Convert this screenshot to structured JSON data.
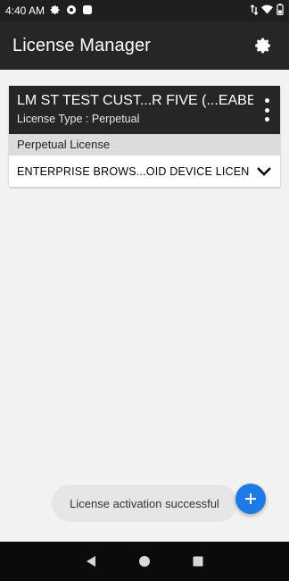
{
  "status_bar": {
    "time": "4:40 AM",
    "icons_left": [
      "gear-icon",
      "notification-icon",
      "square-icon"
    ],
    "icons_right": [
      "data-arrows-icon",
      "wifi-icon",
      "battery-icon"
    ]
  },
  "app_bar": {
    "title": "License Manager",
    "settings_icon": "gear-icon"
  },
  "license_card": {
    "title": "LM ST TEST CUST...R FIVE (...EABE)",
    "subtitle": "License Type : Perpetual",
    "section_label": "Perpetual License",
    "license_item": "ENTERPRISE BROWS...OID DEVICE LICENSE"
  },
  "toast": {
    "message": "License activation successful"
  },
  "fab": {
    "icon": "plus-icon"
  },
  "nav_bar": {
    "icons": [
      "back-icon",
      "home-icon",
      "recents-icon"
    ]
  },
  "colors": {
    "app_bar": "#262626",
    "status_bar": "#1f1f1f",
    "fab": "#1e7be6",
    "background": "#f2f2f2",
    "section": "#dcdcdc"
  }
}
